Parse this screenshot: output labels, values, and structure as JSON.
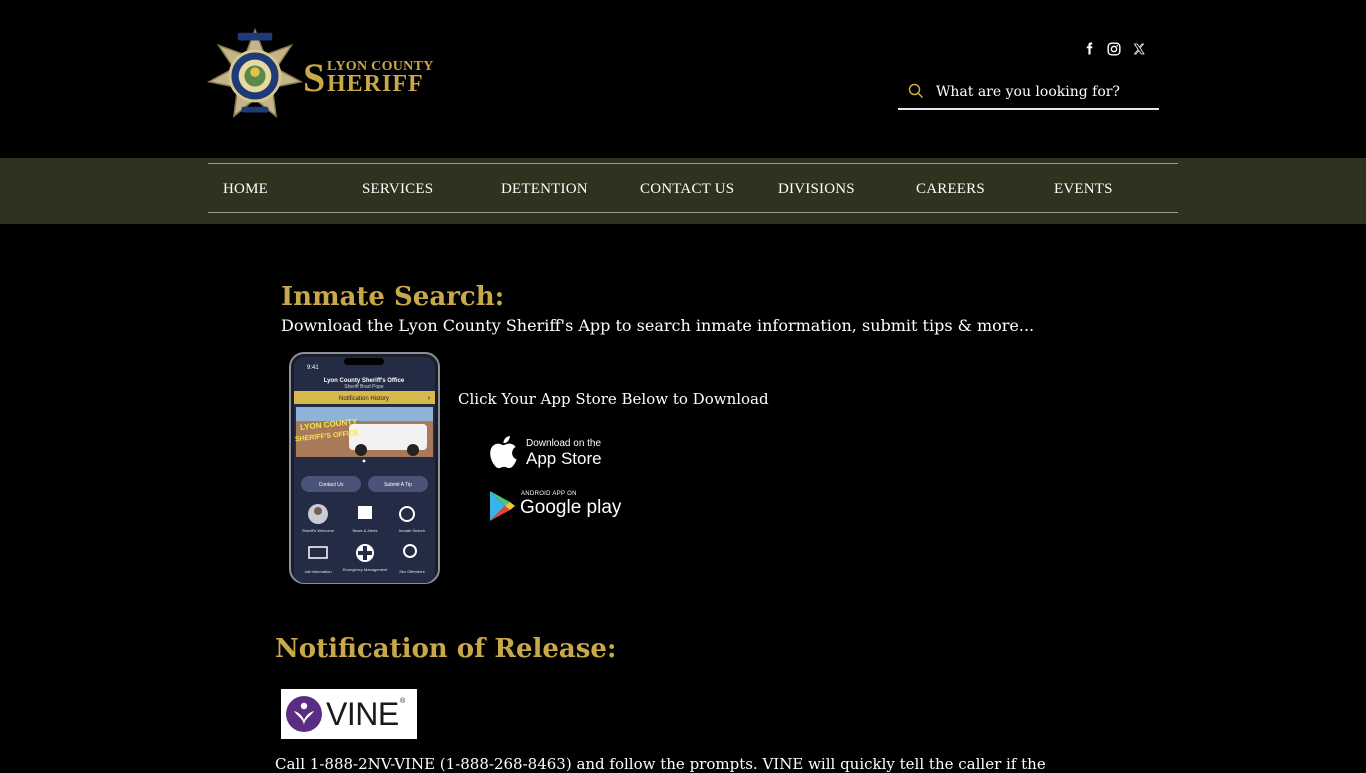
{
  "header": {
    "badge_icon": "sheriff-star-badge",
    "brand_small": "LYON COUNTY",
    "brand_initial": "S",
    "brand_rest": "HERIFF",
    "social": [
      {
        "icon": "facebook-icon"
      },
      {
        "icon": "instagram-icon"
      },
      {
        "icon": "x-twitter-icon"
      }
    ],
    "search": {
      "placeholder": "What are you looking for?",
      "value": ""
    }
  },
  "nav": {
    "items": [
      {
        "label": "HOME"
      },
      {
        "label": "SERVICES"
      },
      {
        "label": "DETENTION"
      },
      {
        "label": "CONTACT US"
      },
      {
        "label": "DIVISIONS"
      },
      {
        "label": "CAREERS"
      },
      {
        "label": "EVENTS"
      }
    ]
  },
  "inmate": {
    "heading": "Inmate Search:",
    "description": "Download the Lyon County Sheriff's App to search inmate information, submit tips & more...",
    "click_label": "Click Your App Store Below to Download",
    "phone": {
      "time": "9:41",
      "title": "Lyon County Sheriff's Office",
      "subtitle": "Sheriff Brad Pope",
      "banner": "Notification History",
      "hero_text_1": "LYON COUNTY",
      "hero_text_2": "SHERIFF'S OFFICE",
      "contact_button": "Contact Us",
      "tip_button": "Submit A Tip",
      "tiles": [
        {
          "label": "Sheriff's Welcome"
        },
        {
          "label": "News & Alerts"
        },
        {
          "label": "Inmate Search"
        },
        {
          "label": "Jail Information"
        },
        {
          "label": "Emergency Management"
        },
        {
          "label": "Sex Offenders"
        }
      ]
    },
    "app_store": {
      "top": "Download on the",
      "bottom": "App Store"
    },
    "google_play": {
      "top": "ANDROID APP ON",
      "bottom": "Google play"
    }
  },
  "release": {
    "heading": "Notification of Release:",
    "vine_word": "VINE",
    "vine_reg": "®",
    "body": "Call 1-888-2NV-VINE (1-888-268-8463) and follow the prompts. VINE will quickly tell the caller if the"
  },
  "colors": {
    "accent_gold": "#c9a84a",
    "nav_bg": "#30311f",
    "page_bg": "#000000",
    "vine_purple": "#5b2d82"
  }
}
